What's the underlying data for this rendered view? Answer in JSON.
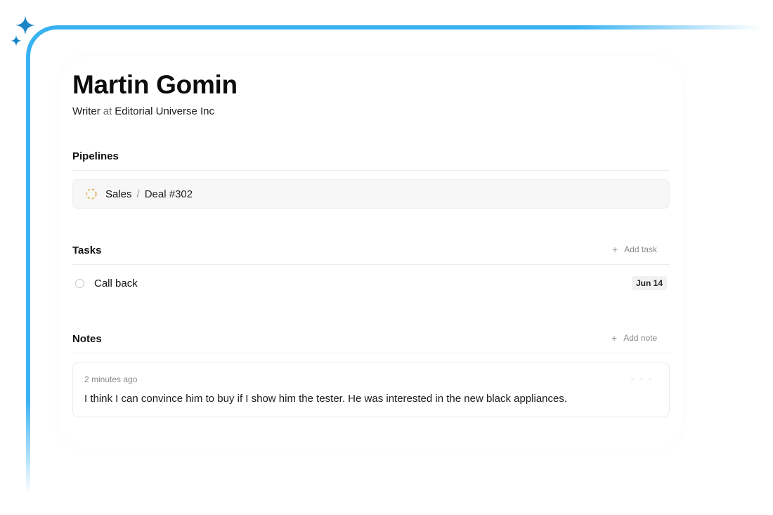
{
  "contact": {
    "name": "Martin Gomin",
    "role": "Writer",
    "at": "at",
    "company": "Editorial Universe Inc"
  },
  "pipelines": {
    "title": "Pipelines",
    "items": [
      {
        "pipeline": "Sales",
        "separator": "/",
        "deal": "Deal #302",
        "status_icon": "dashed-circle-icon",
        "status_color": "#e0b45a"
      }
    ]
  },
  "tasks": {
    "title": "Tasks",
    "add_label": "Add task",
    "items": [
      {
        "label": "Call back",
        "due": "Jun 14"
      }
    ]
  },
  "notes": {
    "title": "Notes",
    "add_label": "Add note",
    "items": [
      {
        "time": "2 minutes ago",
        "text": "I think I can convince him to buy if I show him the tester. He was interested in the new black appliances."
      }
    ]
  },
  "colors": {
    "accent": "#39b2f2",
    "sparkle": "#1a86c8"
  }
}
